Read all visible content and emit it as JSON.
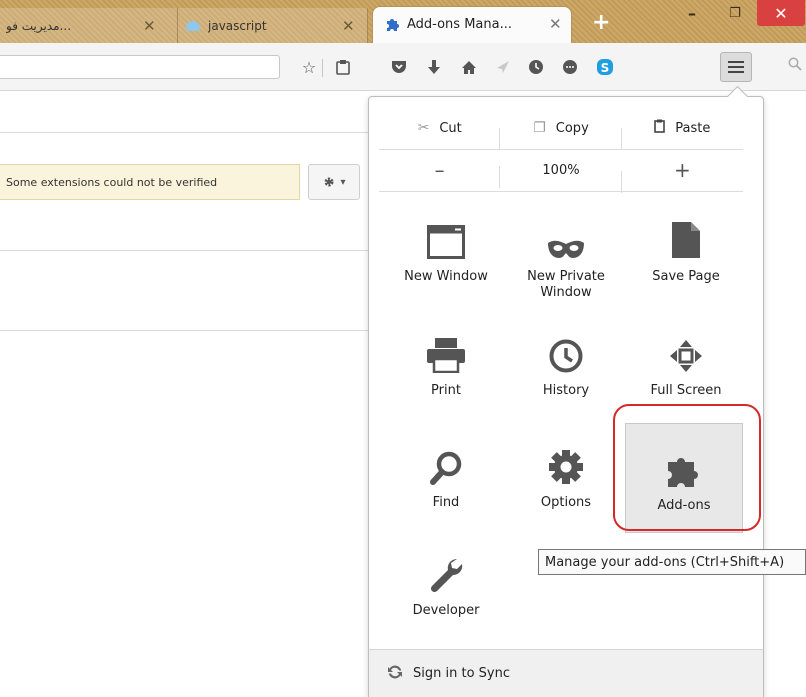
{
  "tabs": [
    {
      "label": "...مدیریت فو",
      "close": "✕"
    },
    {
      "label": "javascript",
      "close": "✕"
    },
    {
      "label": "Add-ons Mana...",
      "close": "✕"
    }
  ],
  "new_tab": "+",
  "window_controls": {
    "minimize": "–",
    "maximize": "❐",
    "close": "✕"
  },
  "toolbar": {
    "icons": [
      "bookmark-star-icon",
      "reading-list-icon",
      "pocket-icon",
      "downloads-icon",
      "home-icon",
      "send-icon",
      "history-badge-icon",
      "chat-icon",
      "skype-icon",
      "menu-icon",
      "search-icon"
    ]
  },
  "page": {
    "notice": "Some extensions could not be verified",
    "gear_caret": "▾"
  },
  "panel": {
    "edit": {
      "cut": "Cut",
      "copy": "Copy",
      "paste": "Paste"
    },
    "zoom": {
      "minus": "–",
      "level": "100%",
      "plus": "+"
    },
    "items": [
      {
        "label": "New Window",
        "icon": "window-icon"
      },
      {
        "label": "New Private Window",
        "icon": "mask-icon"
      },
      {
        "label": "Save Page",
        "icon": "page-icon"
      },
      {
        "label": "Print",
        "icon": "printer-icon"
      },
      {
        "label": "History",
        "icon": "clock-icon"
      },
      {
        "label": "Full Screen",
        "icon": "fullscreen-icon"
      },
      {
        "label": "Find",
        "icon": "magnifier-icon"
      },
      {
        "label": "Options",
        "icon": "gear-icon"
      },
      {
        "label": "Add-ons",
        "icon": "puzzle-icon"
      },
      {
        "label": "Developer",
        "icon": "wrench-icon"
      }
    ],
    "tooltip": "Manage your add-ons (Ctrl+Shift+A)",
    "sync": "Sign in to Sync"
  },
  "colors": {
    "highlight_ring": "#d42a2a",
    "tab_strip": "#c9a15d",
    "close_button": "#d94040"
  }
}
